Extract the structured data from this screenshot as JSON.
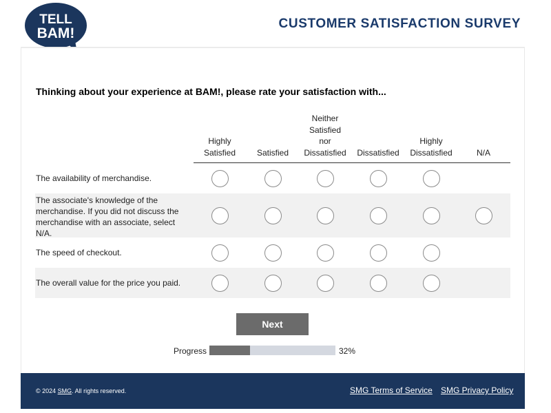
{
  "header": {
    "logo_line1": "TELL",
    "logo_line2": "BAM!",
    "survey_title": "CUSTOMER SATISFACTION SURVEY"
  },
  "question": "Thinking about your experience at BAM!, please rate your satisfaction with...",
  "columns": [
    {
      "lines": [
        "Highly",
        "Satisfied"
      ]
    },
    {
      "lines": [
        "Satisfied"
      ]
    },
    {
      "lines": [
        "Neither",
        "Satisfied",
        "nor",
        "Dissatisfied"
      ]
    },
    {
      "lines": [
        "Dissatisfied"
      ]
    },
    {
      "lines": [
        "Highly",
        "Dissatisfied"
      ]
    },
    {
      "lines": [
        "N/A"
      ]
    }
  ],
  "rows": [
    {
      "label": "The availability of merchandise.",
      "options": 5,
      "selected": null
    },
    {
      "label": "The associate's knowledge of the merchandise. If you did not discuss the merchandise with an associate, select N/A.",
      "options": 6,
      "selected": null
    },
    {
      "label": "The speed of checkout.",
      "options": 5,
      "selected": null
    },
    {
      "label": "The overall value for the price you paid.",
      "options": 5,
      "selected": null
    }
  ],
  "next_label": "Next",
  "progress": {
    "label": "Progress",
    "percent": 32,
    "percent_text": "32%"
  },
  "footer": {
    "copyright_prefix": "© 2024 ",
    "copyright_brand": "SMG",
    "copyright_suffix": ". All rights reserved.",
    "terms_link": "SMG Terms of Service",
    "privacy_link": "SMG Privacy Policy"
  },
  "colors": {
    "brand_navy": "#1b365d",
    "title_blue": "#1a3a6b",
    "button_gray": "#6b6b6b",
    "progress_fill": "#6e6e6e",
    "progress_track": "#d4d8e0"
  }
}
